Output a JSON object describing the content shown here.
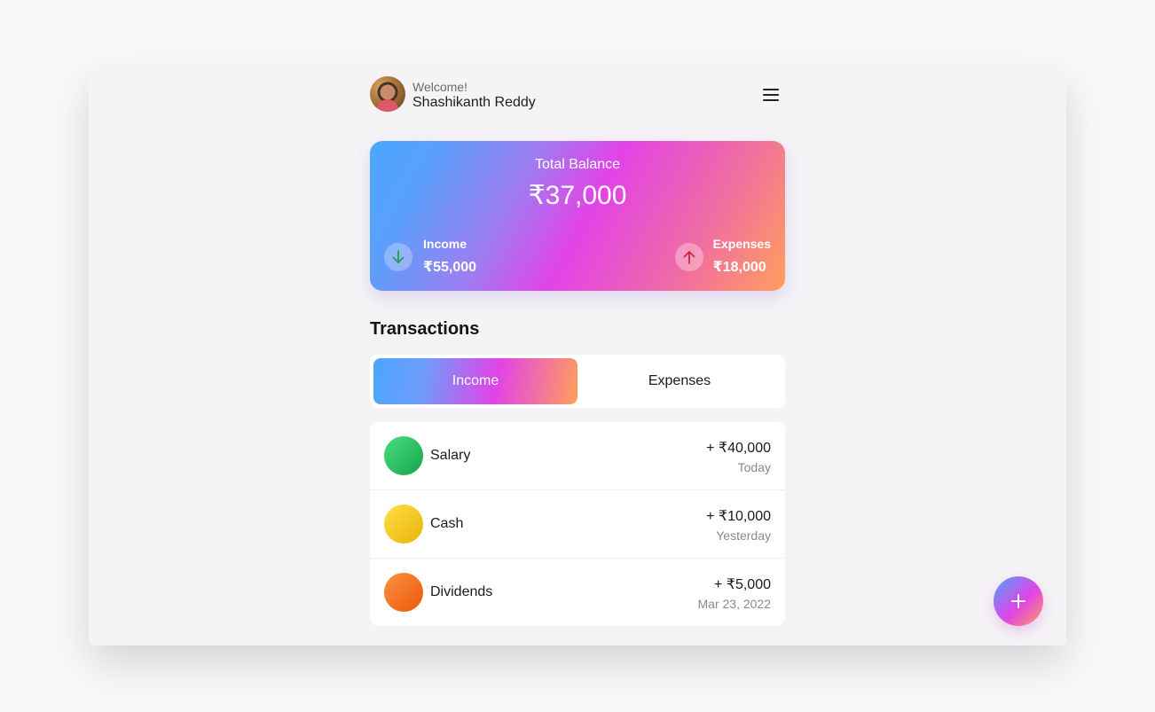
{
  "header": {
    "greeting": "Welcome!",
    "user_name": "Shashikanth Reddy"
  },
  "balance_card": {
    "label": "Total Balance",
    "amount": "₹37,000",
    "income": {
      "label": "Income",
      "value": "₹55,000",
      "icon": "arrow-down-icon"
    },
    "expenses": {
      "label": "Expenses",
      "value": "₹18,000",
      "icon": "arrow-up-icon"
    }
  },
  "transactions": {
    "title": "Transactions",
    "tabs": [
      {
        "label": "Income",
        "active": true
      },
      {
        "label": "Expenses",
        "active": false
      }
    ],
    "items": [
      {
        "name": "Salary",
        "amount": "+ ₹40,000",
        "date": "Today",
        "color_from": "#4ade80",
        "color_to": "#16a34a"
      },
      {
        "name": "Cash",
        "amount": "+ ₹10,000",
        "date": "Yesterday",
        "color_from": "#fde047",
        "color_to": "#eab308"
      },
      {
        "name": "Dividends",
        "amount": "+ ₹5,000",
        "date": "Mar 23, 2022",
        "color_from": "#fb923c",
        "color_to": "#ea580c"
      }
    ]
  },
  "colors": {
    "income_arrow": "#1f9d55",
    "expense_arrow": "#d0263f"
  }
}
